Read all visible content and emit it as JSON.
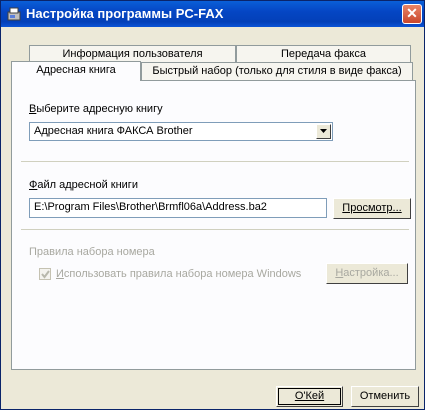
{
  "window": {
    "title": "Настройка программы PC-FAX",
    "app_icon": "pc-fax-icon",
    "close_icon": "close-icon"
  },
  "tabs": {
    "row_back": [
      {
        "label": "Информация пользователя"
      },
      {
        "label": "Передача факса"
      }
    ],
    "row_front": [
      {
        "label": "Адресная книга",
        "active": true
      },
      {
        "label": "Быстрый набор (только для стиля в виде факса)"
      }
    ]
  },
  "address_book": {
    "select_label": "Выберите адресную книгу",
    "select_value": "Адресная книга ФАКСА Brother",
    "file_label": "Файл адресной книги",
    "file_value": "E:\\Program Files\\Brother\\Brmfl06a\\Address.ba2",
    "browse_label": "Просмотр..."
  },
  "dialing_rules": {
    "group_label": "Правила набора номера",
    "checkbox_label": "Использовать правила набора номера Windows",
    "checkbox_checked": true,
    "checkbox_enabled": false,
    "settings_label": "Настройка..."
  },
  "footer": {
    "ok_label": "О'Кей",
    "cancel_label": "Отменить"
  }
}
